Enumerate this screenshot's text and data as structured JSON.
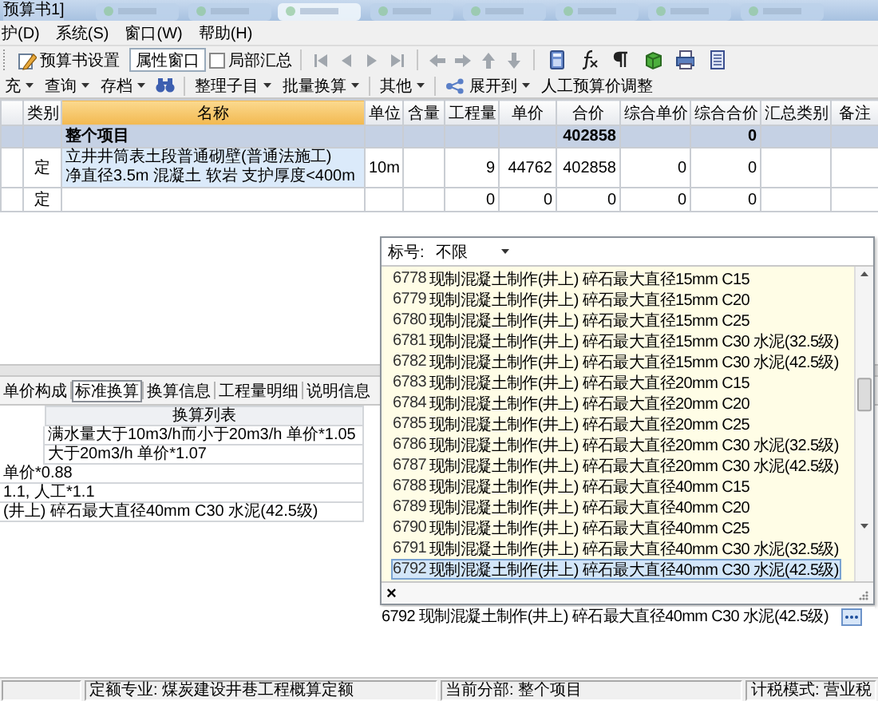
{
  "window": {
    "title": "预算书1]"
  },
  "menu": [
    {
      "label": "护(D)"
    },
    {
      "label": "系统(S)"
    },
    {
      "label": "窗口(W)"
    },
    {
      "label": "帮助(H)"
    }
  ],
  "toolbar_1": {
    "buttons": [
      {
        "label": "预算书设置",
        "pressed": false
      },
      {
        "label": "属性窗口",
        "pressed": true
      }
    ],
    "checkbox": {
      "label": "局部汇总",
      "checked": false
    }
  },
  "toolbar_2": [
    {
      "label": "充",
      "dropdown": true
    },
    {
      "label": "查询",
      "dropdown": true
    },
    {
      "label": "存档",
      "dropdown": true
    },
    {
      "label": "整理子目",
      "dropdown": true
    },
    {
      "label": "批量换算",
      "dropdown": true
    },
    {
      "label": "其他",
      "dropdown": true
    },
    {
      "label": "展开到",
      "dropdown": true
    },
    {
      "label": "人工预算价调整",
      "dropdown": false
    }
  ],
  "table": {
    "columns": [
      {
        "label": "类别",
        "selected": false
      },
      {
        "label": "名称",
        "selected": true
      },
      {
        "label": "单位",
        "selected": false
      },
      {
        "label": "含量",
        "selected": false
      },
      {
        "label": "工程量",
        "selected": false
      },
      {
        "label": "单价",
        "selected": false
      },
      {
        "label": "合价",
        "selected": false
      },
      {
        "label": "综合单价",
        "selected": false
      },
      {
        "label": "综合合价",
        "selected": false
      },
      {
        "label": "汇总类别",
        "selected": false
      },
      {
        "label": "备注",
        "selected": false
      }
    ],
    "rows": [
      {
        "kind": "summary",
        "selected": false,
        "cells": [
          null,
          "整个项目",
          null,
          null,
          null,
          null,
          "402858",
          null,
          "0",
          null,
          null
        ]
      },
      {
        "kind": "item",
        "selected": true,
        "cells": [
          "定",
          "立井井筒表土段普通砌壁(普通法施工)\n净直径3.5m 混凝土 软岩 支护厚度<400m",
          "10m",
          null,
          "9",
          "44762",
          "402858",
          "0",
          "0",
          null,
          null
        ]
      },
      {
        "kind": "item",
        "selected": false,
        "cells": [
          "定",
          null,
          null,
          null,
          "0",
          "0",
          "0",
          "0",
          "0",
          null,
          null
        ]
      }
    ]
  },
  "calc_panel": {
    "tabs": [
      {
        "label": "单价构成",
        "selected": false
      },
      {
        "label": "标准换算",
        "selected": true
      },
      {
        "label": "换算信息",
        "selected": false
      },
      {
        "label": "工程量明细",
        "selected": false
      },
      {
        "label": "说明信息",
        "selected": false
      }
    ],
    "list_header": "换算列表",
    "rows": [
      {
        "kind": "sub",
        "text": "满水量大于10m3/h而小于20m3/h 单价*1.05"
      },
      {
        "kind": "sub",
        "text": "大于20m3/h 单价*1.07"
      },
      {
        "kind": "main",
        "text": "单价*0.88"
      },
      {
        "kind": "main",
        "text": "1.1, 人工*1.1"
      },
      {
        "kind": "main",
        "text": "(井上) 碎石最大直径40mm C30 水泥(42.5级)"
      }
    ]
  },
  "code_popup": {
    "filter_label": "标号:",
    "filter_value": "不限",
    "items": [
      {
        "code": "6778",
        "name": "现制混凝土制作(井上) 碎石最大直径15mm C15",
        "selected": false
      },
      {
        "code": "6779",
        "name": "现制混凝土制作(井上) 碎石最大直径15mm C20",
        "selected": false
      },
      {
        "code": "6780",
        "name": "现制混凝土制作(井上) 碎石最大直径15mm C25",
        "selected": false
      },
      {
        "code": "6781",
        "name": "现制混凝土制作(井上) 碎石最大直径15mm C30 水泥(32.5级)",
        "selected": false
      },
      {
        "code": "6782",
        "name": "现制混凝土制作(井上) 碎石最大直径15mm C30 水泥(42.5级)",
        "selected": false
      },
      {
        "code": "6783",
        "name": "现制混凝土制作(井上) 碎石最大直径20mm C15",
        "selected": false
      },
      {
        "code": "6784",
        "name": "现制混凝土制作(井上) 碎石最大直径20mm C20",
        "selected": false
      },
      {
        "code": "6785",
        "name": "现制混凝土制作(井上) 碎石最大直径20mm C25",
        "selected": false
      },
      {
        "code": "6786",
        "name": "现制混凝土制作(井上) 碎石最大直径20mm C30 水泥(32.5级)",
        "selected": false
      },
      {
        "code": "6787",
        "name": "现制混凝土制作(井上) 碎石最大直径20mm C30 水泥(42.5级)",
        "selected": false
      },
      {
        "code": "6788",
        "name": "现制混凝土制作(井上) 碎石最大直径40mm C15",
        "selected": false
      },
      {
        "code": "6789",
        "name": "现制混凝土制作(井上) 碎石最大直径40mm C20",
        "selected": false
      },
      {
        "code": "6790",
        "name": "现制混凝土制作(井上) 碎石最大直径40mm C25",
        "selected": false
      },
      {
        "code": "6791",
        "name": "现制混凝土制作(井上) 碎石最大直径40mm C30 水泥(32.5级)",
        "selected": false
      },
      {
        "code": "6792",
        "name": "现制混凝土制作(井上) 碎石最大直径40mm C30 水泥(42.5级)",
        "selected": true
      }
    ],
    "close": "×",
    "field_value": "6792  现制混凝土制作(井上) 碎石最大直径40mm C30 水泥(42.5级)"
  },
  "status_bar": [
    {
      "text": "定额专业: 煤炭建设井巷工程概算定额"
    },
    {
      "text": "当前分部: 整个项目"
    },
    {
      "text": "计税模式: 营业税"
    }
  ]
}
